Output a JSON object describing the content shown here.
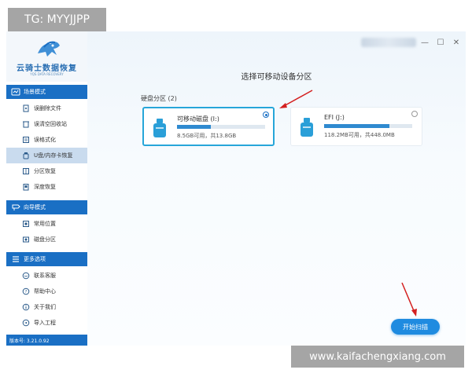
{
  "watermarks": {
    "top": "TG: MYYJJPP",
    "bottom": "www.kaifachengxiang.com"
  },
  "brand": {
    "name": "云骑士数据恢复",
    "subtitle": "YQS DATA RECOVERY"
  },
  "sidebar": {
    "sections": [
      {
        "label": "场景模式",
        "icon": "scene-icon",
        "items": [
          {
            "label": "误删除文件",
            "icon": "delete-file-icon"
          },
          {
            "label": "误清空回收站",
            "icon": "recycle-bin-icon"
          },
          {
            "label": "误格式化",
            "icon": "format-icon"
          },
          {
            "label": "U盘/内存卡恢复",
            "icon": "usb-card-icon",
            "active": true
          },
          {
            "label": "分区恢复",
            "icon": "partition-icon"
          },
          {
            "label": "深度恢复",
            "icon": "deep-recovery-icon"
          }
        ]
      },
      {
        "label": "向导模式",
        "icon": "guide-icon",
        "items": [
          {
            "label": "常用位置",
            "icon": "location-icon"
          },
          {
            "label": "磁盘分区",
            "icon": "disk-icon"
          }
        ]
      },
      {
        "label": "更多选项",
        "icon": "menu-icon",
        "items": [
          {
            "label": "联系客服",
            "icon": "support-icon"
          },
          {
            "label": "帮助中心",
            "icon": "help-icon"
          },
          {
            "label": "关于我们",
            "icon": "about-icon"
          },
          {
            "label": "导入工程",
            "icon": "import-icon"
          }
        ]
      }
    ],
    "version": "版本号: 3.21.0.92"
  },
  "main": {
    "title": "选择可移动设备分区",
    "section_label": "硬盘分区 (2)",
    "drives": [
      {
        "name": "可移动磁盘 (I:)",
        "capacity": "8.5GB可用，共13.8GB",
        "used_fraction": 0.38,
        "selected": true
      },
      {
        "name": "EFI (J:)",
        "capacity": "118.2MB可用，共448.0MB",
        "used_fraction": 0.74,
        "selected": false
      }
    ],
    "start_button": "开始扫描"
  },
  "window": {
    "minimize": "—",
    "maximize": "☐",
    "close": "✕"
  },
  "colors": {
    "accent": "#1a6fc4",
    "selected_border": "#27a6d9",
    "annotation_red": "#d42020"
  }
}
